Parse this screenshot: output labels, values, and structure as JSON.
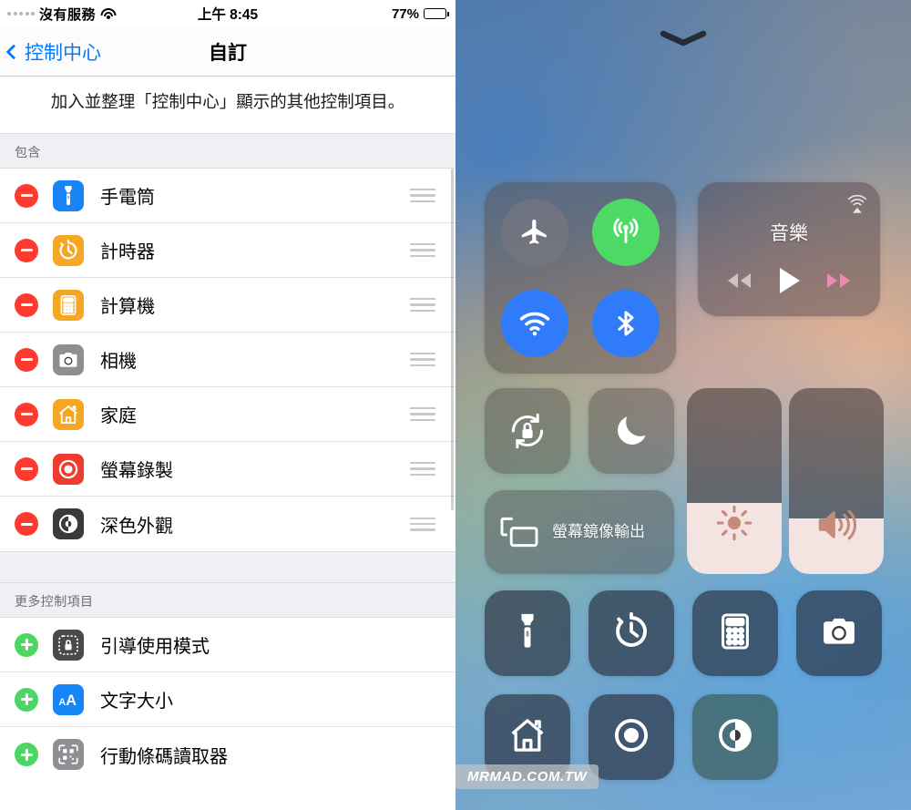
{
  "status_bar": {
    "carrier": "沒有服務",
    "wifi_icon": "wifi-icon",
    "time": "上午 8:45",
    "battery_percent": "77%",
    "battery_level": 77
  },
  "nav": {
    "back_label": "控制中心",
    "back_icon": "chevron-left-icon",
    "title": "自訂"
  },
  "description": "加入並整理「控制中心」顯示的其他控制項目。",
  "included": {
    "header": "包含",
    "items": [
      {
        "label": "手電筒",
        "icon": "flashlight-icon",
        "icon_bg": "#1785f5",
        "action": "remove"
      },
      {
        "label": "計時器",
        "icon": "timer-icon",
        "icon_bg": "#f5a623",
        "action": "remove"
      },
      {
        "label": "計算機",
        "icon": "calculator-icon",
        "icon_bg": "#f5a623",
        "action": "remove"
      },
      {
        "label": "相機",
        "icon": "camera-icon",
        "icon_bg": "#8e8e93",
        "action": "remove"
      },
      {
        "label": "家庭",
        "icon": "home-icon",
        "icon_bg": "#f5a623",
        "action": "remove"
      },
      {
        "label": "螢幕錄製",
        "icon": "screen-record-icon",
        "icon_bg": "#f03c2e",
        "action": "remove"
      },
      {
        "label": "深色外觀",
        "icon": "dark-mode-icon",
        "icon_bg": "#3a3a3c",
        "action": "remove"
      }
    ]
  },
  "more_controls": {
    "header": "更多控制項目",
    "items": [
      {
        "label": "引導使用模式",
        "icon": "guided-access-icon",
        "icon_bg": "#4a4a4c",
        "action": "add"
      },
      {
        "label": "文字大小",
        "icon": "text-size-icon",
        "icon_bg": "#1785f5",
        "action": "add"
      },
      {
        "label": "行動條碼讀取器",
        "icon": "qr-scanner-icon",
        "icon_bg": "#8e8e93",
        "action": "add"
      }
    ]
  },
  "control_center": {
    "grabber_icon": "chevron-down-icon",
    "toggles": [
      {
        "name": "airplane-mode",
        "icon": "airplane-icon",
        "state": "off"
      },
      {
        "name": "cellular-data",
        "icon": "cellular-icon",
        "state": "on-green"
      },
      {
        "name": "wifi",
        "icon": "wifi-icon",
        "state": "on-blue"
      },
      {
        "name": "bluetooth",
        "icon": "bluetooth-icon",
        "state": "on-blue"
      }
    ],
    "music": {
      "title": "音樂",
      "airplay_icon": "airplay-icon",
      "prev_icon": "rewind-icon",
      "play_icon": "play-icon",
      "next_icon": "fast-forward-icon"
    },
    "rotation_lock": {
      "icon": "rotation-lock-icon"
    },
    "do_not_disturb": {
      "icon": "moon-icon"
    },
    "screen_mirroring": {
      "label": "螢幕鏡像輸出",
      "icon": "screen-mirroring-icon"
    },
    "brightness": {
      "icon": "brightness-icon",
      "level": 38
    },
    "volume": {
      "icon": "volume-icon",
      "level": 30
    },
    "shortcuts": [
      {
        "name": "flashlight",
        "icon": "flashlight-icon",
        "tint": "dark"
      },
      {
        "name": "timer",
        "icon": "timer-icon",
        "tint": "dark"
      },
      {
        "name": "calculator",
        "icon": "calculator-icon",
        "tint": "dark"
      },
      {
        "name": "camera",
        "icon": "camera-icon",
        "tint": "dark"
      },
      {
        "name": "home",
        "icon": "home-icon",
        "tint": "dark"
      },
      {
        "name": "screen-recording",
        "icon": "screen-record-icon",
        "tint": "dark"
      },
      {
        "name": "dark-mode",
        "icon": "dark-mode-icon",
        "tint": "greenish"
      }
    ]
  },
  "watermark": "MRMAD.COM.TW"
}
